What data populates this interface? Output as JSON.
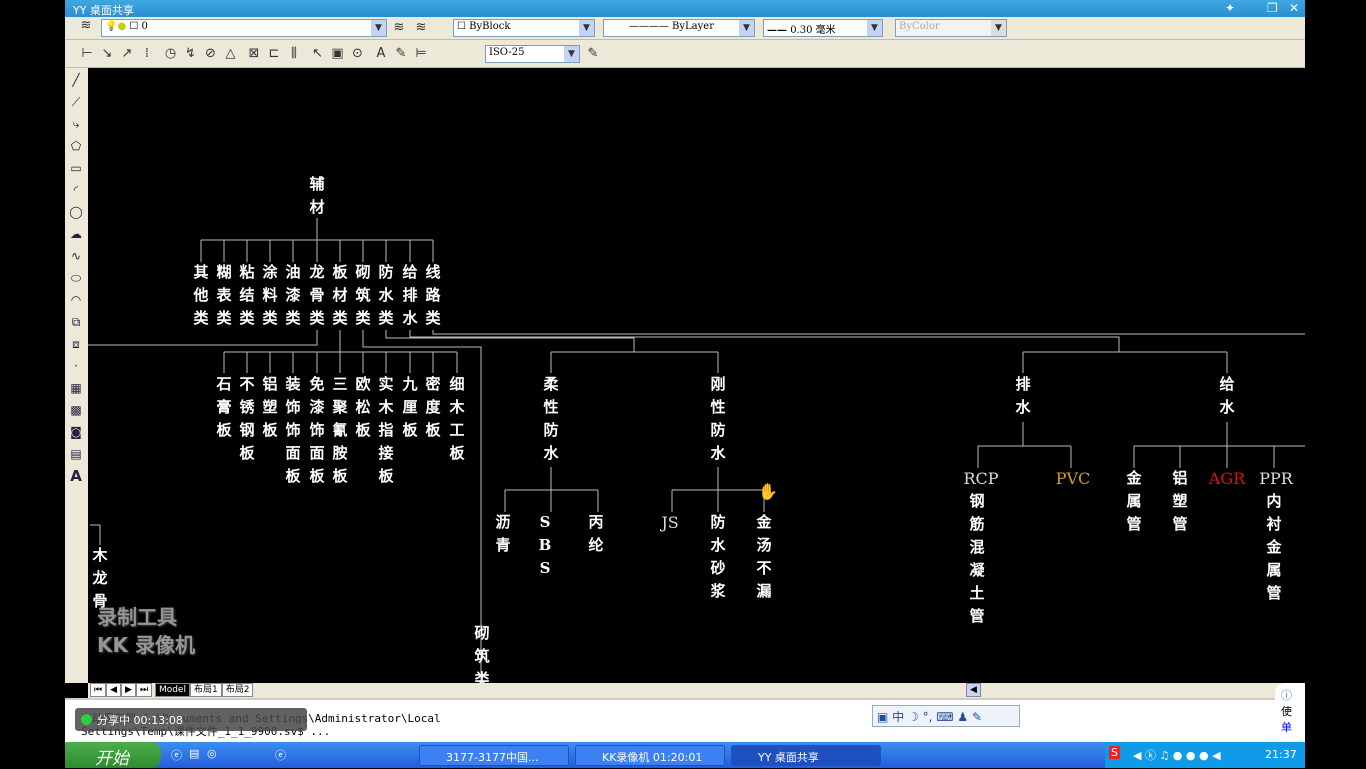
{
  "window": {
    "title": "YY 桌面共享"
  },
  "toolbar1": {
    "layer": "0",
    "color": "ByBlock",
    "linetype": "ByLayer",
    "lineweight": "0.30 毫米",
    "plotstyle": "ByColor"
  },
  "toolbar2": {
    "dimstyle": "ISO-25"
  },
  "tree": {
    "root": "辅材",
    "level1": [
      "其他类",
      "糊表类",
      "粘结类",
      "涂料类",
      "油漆类",
      "龙骨类",
      "板材类",
      "砌筑类",
      "防水类",
      "给排水",
      "线路类"
    ],
    "boards": [
      "石膏板",
      "不锈钢板",
      "铝塑板",
      "装饰饰面板",
      "免漆饰面板",
      "三聚氰胺板",
      "欧松板",
      "实木指接板",
      "九厘板",
      "密度板",
      "细木工板"
    ],
    "keel": "木龙骨",
    "masonry": "砌筑类",
    "waterproof": [
      "柔性防水",
      "刚性防水"
    ],
    "flexible": [
      "沥青",
      "SBS",
      "丙纶"
    ],
    "rigid": {
      "js": "JS",
      "items": [
        "防水砂浆",
        "金汤不漏"
      ]
    },
    "plumbing": [
      "排水",
      "给水"
    ],
    "drain": {
      "rcp": "RCP",
      "rcp_desc": "钢筋混凝土管",
      "pvc": "PVC"
    },
    "supply": {
      "metal": "金属管",
      "alplastic": "铝塑管",
      "agr": "AGR",
      "ppr": "PPR",
      "ppr_desc": "内衬金属管"
    }
  },
  "colors": {
    "pvc": "#d4a017",
    "agr": "#e01010"
  },
  "layout_tabs": [
    "Model",
    "布局1",
    "布局2"
  ],
  "command": {
    "line1": "自动保存到 C:\\Documents and Settings\\Administrator\\Local",
    "line2": "Settings\\Temp\\课件文件_1_1_9900.sv$ ..."
  },
  "share": {
    "status": "分享中",
    "time": "00:13:08"
  },
  "watermark": {
    "line1": "录制工具",
    "line2": "KK 录像机"
  },
  "ime": {
    "mode": "中"
  },
  "side_widget": {
    "t1": "使",
    "t2": "单"
  },
  "taskbar": {
    "start": "开始",
    "tasks": [
      "3177-3177中国...",
      "KK录像机 01:20:01",
      "YY 桌面共享"
    ],
    "clock": "21:37"
  }
}
